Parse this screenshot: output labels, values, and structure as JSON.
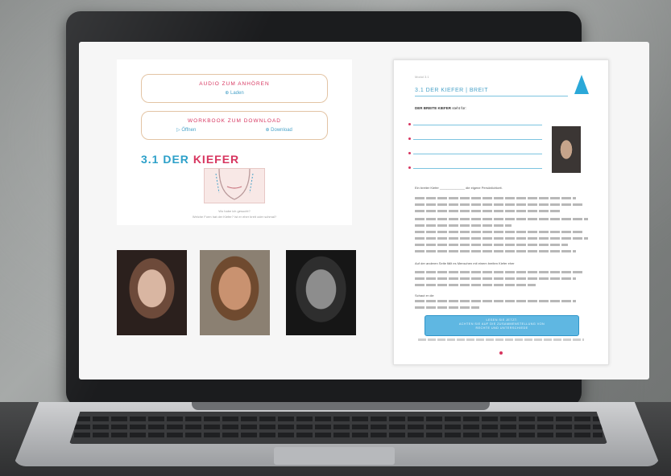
{
  "slide": {
    "audio_title": "AUDIO ZUM ANHÖREN",
    "audio_action": "⊕ Laden",
    "workbook_title": "WORKBOOK ZUM DOWNLOAD",
    "workbook_open": "▷ Öffnen",
    "workbook_download": "⊕ Download",
    "heading_num": "3.1 DER",
    "heading_word": "KIEFER",
    "caption_1": "Wo habe ich gesucht?",
    "caption_2": "Welche Form hat der Kiefer? Ist er eher breit oder schmal?"
  },
  "workbook": {
    "crumb": "Modul 3.1",
    "title": "3.1 DER KIEFER | BREIT",
    "intro_bold": "DER BREITE KIEFER",
    "intro_rest": "steht für:",
    "paragraph_1": "Ein breiter Kiefer ______________ die eigene Persönlichkeit.",
    "paragraph_2": "Auf der anderen Seite fällt es Menschen mit einem breiten Kiefer eher",
    "paragraph_3": "Schaut er die",
    "button_line_1": "LESEN SIE JETZT:",
    "button_line_2": "ACHTEN SIE AUF DIE ZUSAMMENSTELLUNG VON",
    "button_line_3": "RECHTE UND UNTERSCHIEDE"
  },
  "colors": {
    "accent_pink": "#d7355f",
    "accent_blue": "#2ca0c9"
  }
}
